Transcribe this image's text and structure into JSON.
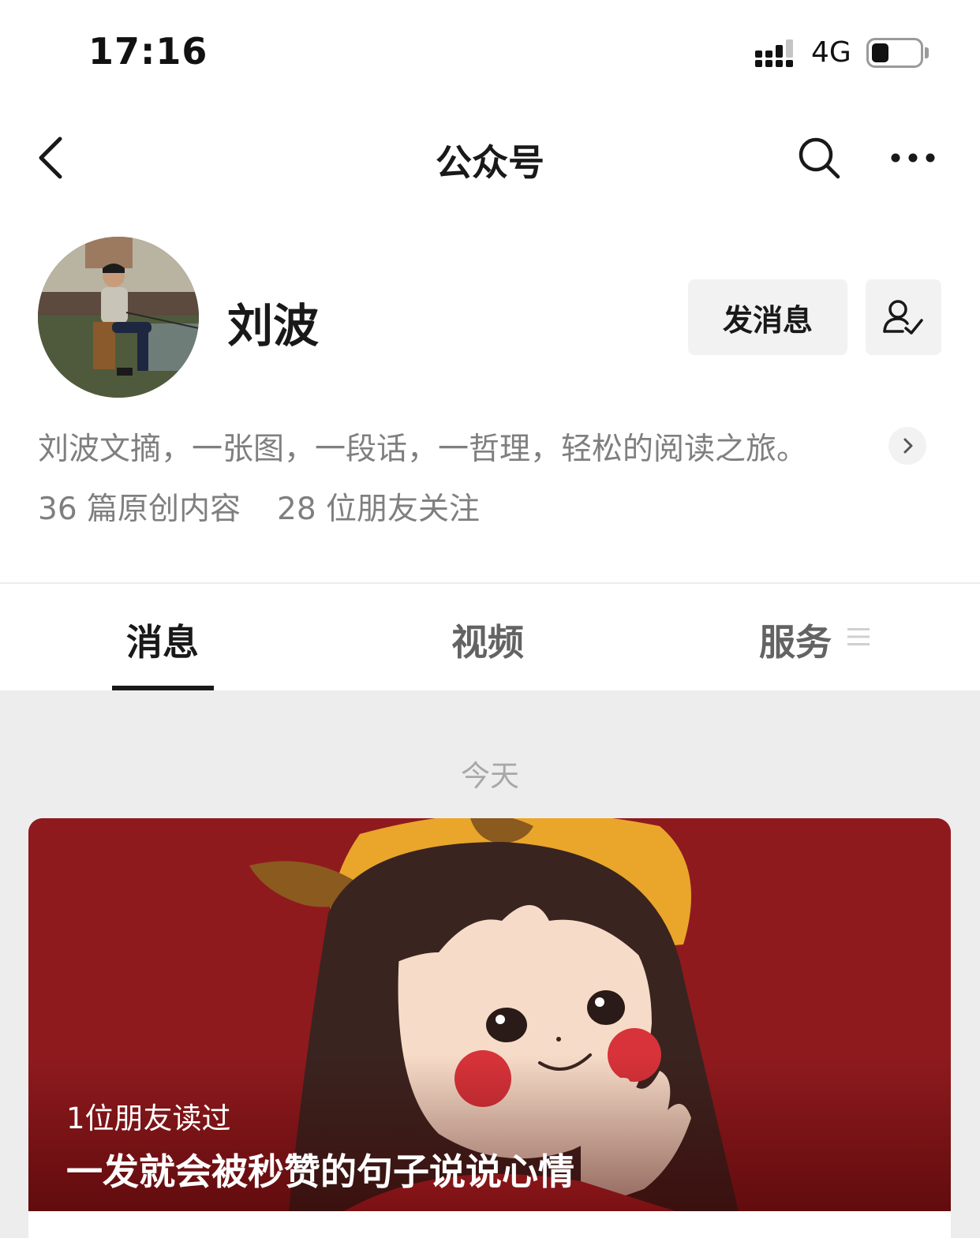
{
  "status_bar": {
    "time": "17:16",
    "network": "4G",
    "battery_level": 0.35
  },
  "nav": {
    "title": "公众号",
    "icons": [
      "back-arrow-icon",
      "search-icon",
      "more-icon"
    ]
  },
  "profile": {
    "name": "刘波",
    "send_message_label": "发消息",
    "follow_icon": "user-check-icon",
    "description": "刘波文摘，一张图，一段话，一哲理，轻松的阅读之旅。",
    "original_count": "36 篇原创内容",
    "friends_following": "28 位朋友关注"
  },
  "tabs": [
    {
      "label": "消息",
      "active": true
    },
    {
      "label": "视频",
      "active": false
    },
    {
      "label": "服务",
      "active": false,
      "icon": "menu-lines-icon"
    }
  ],
  "feed": {
    "date_label": "今天",
    "article": {
      "read_by": "1位朋友读过",
      "title": "一发就会被秒赞的句子说说心情"
    }
  },
  "colors": {
    "card_red": "#8f1a1e",
    "secondary_text": "#7f7f7f",
    "feed_background": "#ededed"
  }
}
